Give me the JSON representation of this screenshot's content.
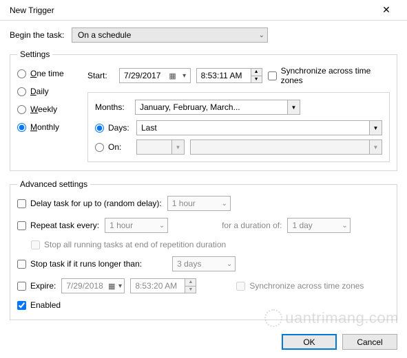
{
  "window": {
    "title": "New Trigger"
  },
  "begin": {
    "label": "Begin the task:",
    "value": "On a schedule"
  },
  "settings": {
    "legend": "Settings",
    "options": {
      "one_time": "One time",
      "daily": "Daily",
      "weekly": "Weekly",
      "monthly": "Monthly",
      "selected": "monthly"
    },
    "start": {
      "label": "Start:",
      "date": "7/29/2017",
      "time": "8:53:11 AM"
    },
    "sync_tz_label": "Synchronize across time zones",
    "monthly": {
      "months_label": "Months:",
      "months_value": "January, February, March...",
      "days_label": "Days:",
      "days_value": "Last",
      "on_label": "On:",
      "day_mode_selected": "days"
    }
  },
  "advanced": {
    "legend": "Advanced settings",
    "delay_label": "Delay task for up to (random delay):",
    "delay_value": "1 hour",
    "repeat_label": "Repeat task every:",
    "repeat_value": "1 hour",
    "duration_label": "for a duration of:",
    "duration_value": "1 day",
    "stop_all_label": "Stop all running tasks at end of repetition duration",
    "stop_longer_label": "Stop task if it runs longer than:",
    "stop_longer_value": "3 days",
    "expire_label": "Expire:",
    "expire_date": "7/29/2018",
    "expire_time": "8:53:20 AM",
    "sync_tz2_label": "Synchronize across time zones",
    "enabled_label": "Enabled"
  },
  "buttons": {
    "ok": "OK",
    "cancel": "Cancel"
  },
  "watermark": "uantrimang.com"
}
